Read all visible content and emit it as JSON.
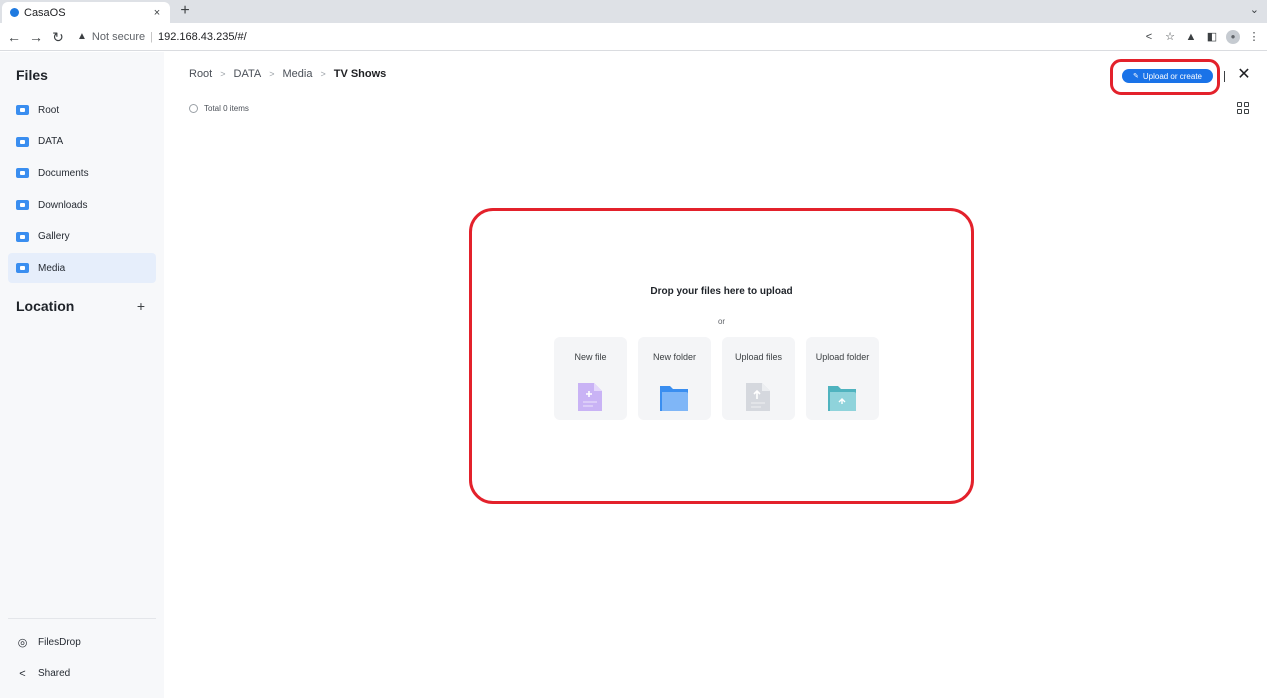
{
  "browser": {
    "tab_title": "CasaOS",
    "tab_close": "×",
    "new_tab": "+",
    "tab_menu": "⌄",
    "security_label": "Not secure",
    "url_separator": "|",
    "url": "192.168.43.235/#/"
  },
  "sidebar": {
    "files_heading": "Files",
    "items": [
      {
        "label": "Root"
      },
      {
        "label": "DATA"
      },
      {
        "label": "Documents"
      },
      {
        "label": "Downloads"
      },
      {
        "label": "Gallery"
      },
      {
        "label": "Media",
        "active": true
      }
    ],
    "location_heading": "Location",
    "location_add": "+",
    "bottom": [
      {
        "label": "FilesDrop",
        "icon": "filesdrop-icon"
      },
      {
        "label": "Shared",
        "icon": "share-icon"
      }
    ]
  },
  "breadcrumb": {
    "items": [
      "Root",
      "DATA",
      "Media"
    ],
    "separator": ">",
    "current": "TV Shows"
  },
  "total_label": "Total 0 items",
  "upload_button_label": "Upload or create",
  "close_symbol": "✕",
  "drop_zone": {
    "title": "Drop your files here to upload",
    "or": "or",
    "cards": [
      {
        "label": "New file",
        "icon": "new-file-icon"
      },
      {
        "label": "New folder",
        "icon": "new-folder-icon"
      },
      {
        "label": "Upload files",
        "icon": "upload-file-icon"
      },
      {
        "label": "Upload folder",
        "icon": "upload-folder-icon"
      }
    ]
  },
  "colors": {
    "accent": "#1a73e8",
    "highlight": "#e3212b",
    "sidebar_active": "#e6eefb",
    "folder_icon": "#3a8ef0"
  }
}
